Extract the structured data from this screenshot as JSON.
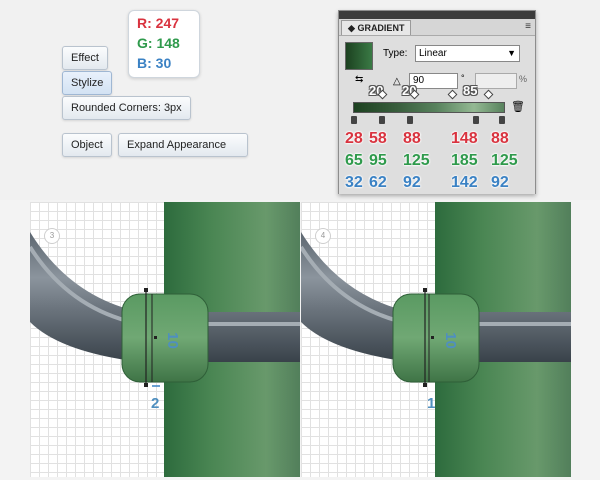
{
  "buttons": {
    "effect": "Effect",
    "stylize": "Stylize",
    "rounded_corners": "Rounded Corners: 3px",
    "object": "Object",
    "expand_appearance": "Expand Appearance"
  },
  "rgb": {
    "r": "R: 247",
    "g": "G: 148",
    "b": "B: 30",
    "colors": {
      "r": "#d9333f",
      "g": "#2f9a4c",
      "b": "#3b82c4"
    }
  },
  "gradient_panel": {
    "title": "GRADIENT",
    "type_label": "Type:",
    "type_value": "Linear",
    "angle_value": "90",
    "small_labels": [
      "20",
      "20",
      "85"
    ],
    "percent": "%"
  },
  "stops": [
    {
      "r": "28",
      "g": "65",
      "b": "32"
    },
    {
      "r": "58",
      "g": "95",
      "b": "62"
    },
    {
      "r": "88",
      "g": "125",
      "b": "92"
    },
    {
      "r": "148",
      "g": "185",
      "b": "142"
    },
    {
      "r": "88",
      "g": "125",
      "b": "92"
    }
  ],
  "scenes": [
    {
      "step": "3",
      "vertical_measure": "10",
      "horizontal_measure": "2"
    },
    {
      "step": "4",
      "vertical_measure": "10",
      "horizontal_measure": "1"
    }
  ]
}
